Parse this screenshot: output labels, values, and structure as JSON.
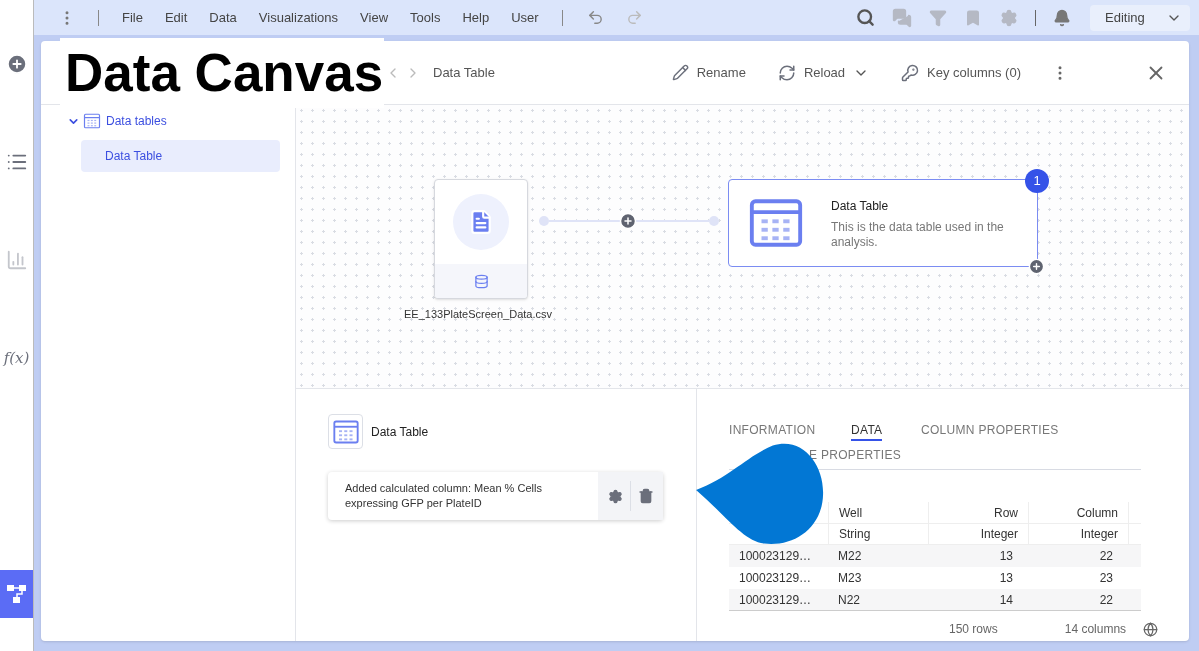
{
  "rail": [
    {
      "selected": false
    },
    {
      "selected": false
    },
    {
      "selected": false
    },
    {
      "selected": false,
      "label": "f(x)"
    },
    {
      "selected": true
    }
  ],
  "menu": [
    "File",
    "Edit",
    "Data",
    "Visualizations",
    "View",
    "Tools",
    "Help",
    "User"
  ],
  "mode": "Editing",
  "overlay_title": "Data Canvas",
  "header": {
    "breadcrumb": "Data Table",
    "actions": [
      "Rename",
      "Reload",
      "Key columns (0)"
    ]
  },
  "tree": {
    "label": "Data tables",
    "expanded": true,
    "children": [
      {
        "label": "Data Table",
        "selected": true
      }
    ]
  },
  "canvas": {
    "source": {
      "filename": "EE_133PlateScreen_Data.csv"
    },
    "table_node": {
      "title": "Data Table",
      "description": "This is the data table used in the analysis.",
      "badge": "1"
    }
  },
  "detail": {
    "title": "Data Table",
    "transformations": [
      {
        "text": "Added calculated column: Mean % Cells expressing GFP per PlateID"
      }
    ]
  },
  "tabs": [
    {
      "label": "INFORMATION",
      "selected": false
    },
    {
      "label": "DATA",
      "selected": true
    },
    {
      "label": "COLUMN PROPERTIES",
      "selected": false
    },
    {
      "label": "E PROPERTIES",
      "selected": false
    }
  ],
  "table": {
    "columns": [
      {},
      {
        "name": "Well",
        "type": "String"
      },
      {
        "name": "Row",
        "type": "Integer"
      },
      {
        "name": "Column",
        "type": "Integer"
      }
    ],
    "rows": [
      [
        "100023129…",
        "M22",
        "13",
        "22"
      ],
      [
        "100023129…",
        "M23",
        "13",
        "23"
      ],
      [
        "100023129…",
        "N22",
        "14",
        "22"
      ]
    ]
  },
  "footer": {
    "rows": "150 rows",
    "columns": "14 columns"
  }
}
